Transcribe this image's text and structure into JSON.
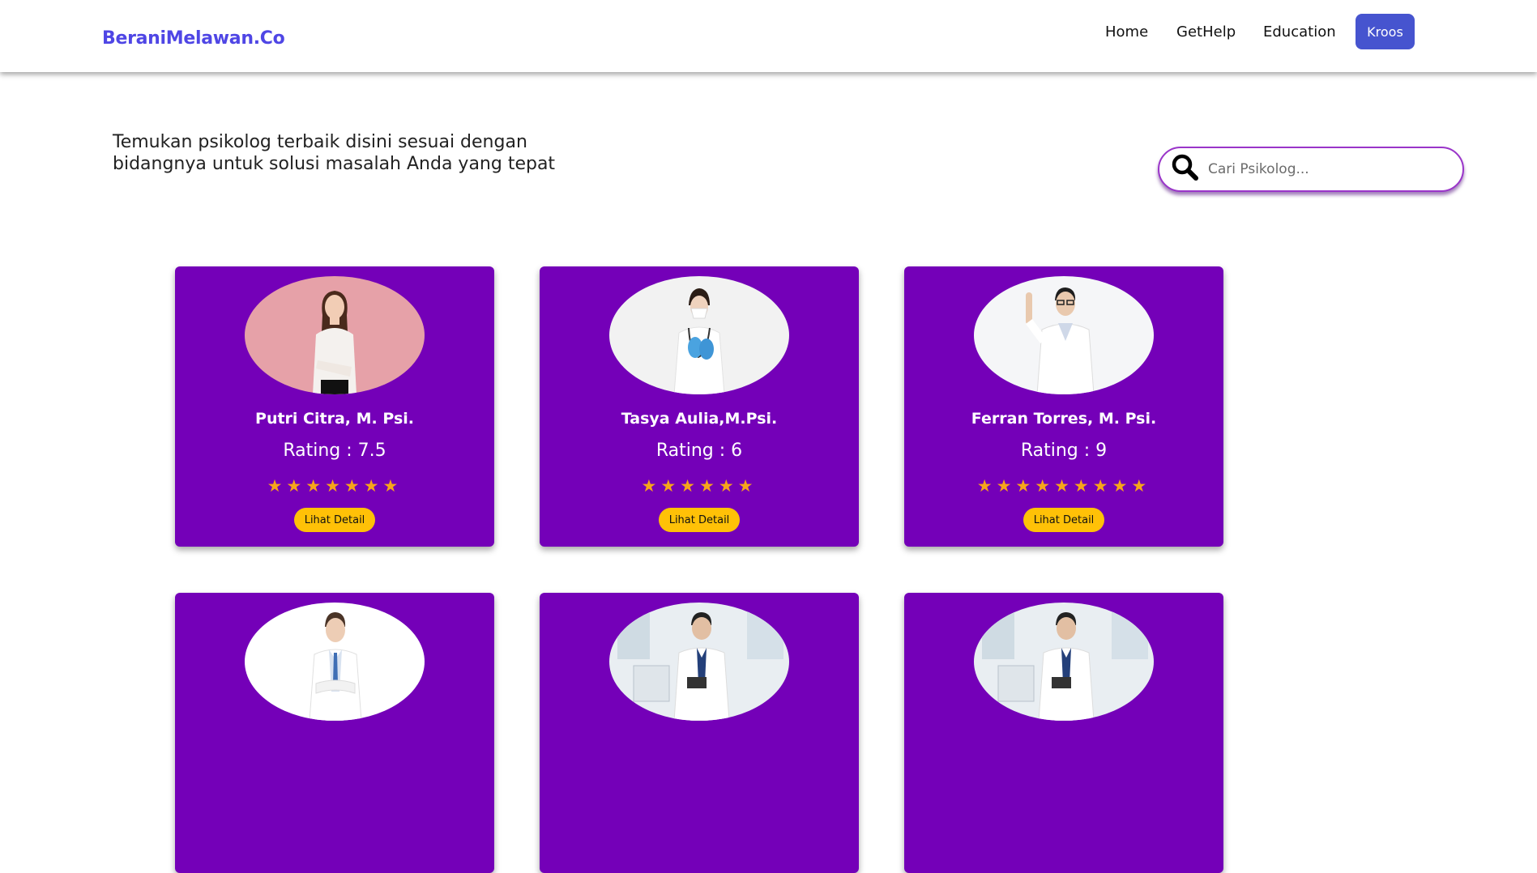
{
  "nav": {
    "brand": "BeraniMelawan.Co",
    "links": [
      "Home",
      "GetHelp",
      "Education"
    ],
    "user": "Kroos"
  },
  "intro": "Temukan psikolog terbaik disini sesuai dengan bidangnya untuk solusi masalah Anda yang tepat",
  "search": {
    "placeholder": "Cari Psikolog..."
  },
  "colors": {
    "card": "#7400b8",
    "brand": "#4f46e5",
    "button": "#ffc107",
    "star": "#f7a51a",
    "user_button": "#4654cf"
  },
  "cards": [
    {
      "name": "Putri Citra, M. Psi.",
      "rating": "Rating : 7.5",
      "stars": "★★★★★★★",
      "button": "Lihat Detail"
    },
    {
      "name": "Tasya Aulia,M.Psi.",
      "rating": "Rating : 6",
      "stars": "★★★★★★",
      "button": "Lihat Detail"
    },
    {
      "name": "Ferran Torres, M. Psi.",
      "rating": "Rating : 9",
      "stars": "★★★★★★★★★",
      "button": "Lihat Detail"
    },
    {
      "name": "",
      "rating": "",
      "stars": "",
      "button": ""
    },
    {
      "name": "",
      "rating": "",
      "stars": "",
      "button": ""
    },
    {
      "name": "",
      "rating": "",
      "stars": "",
      "button": ""
    }
  ]
}
